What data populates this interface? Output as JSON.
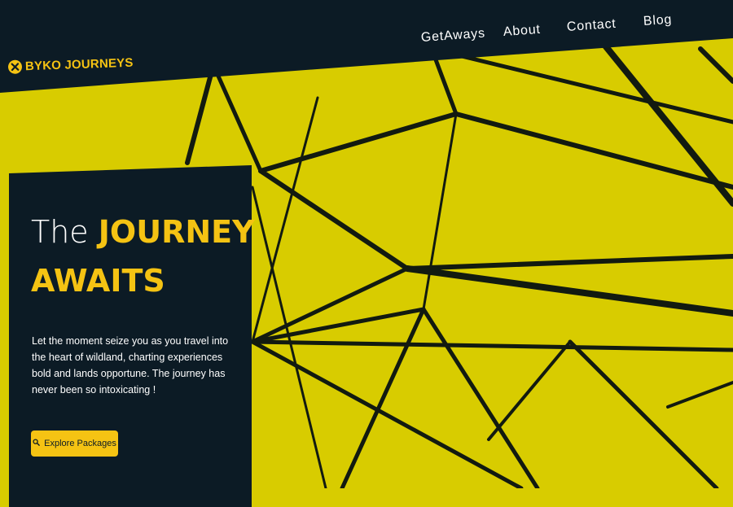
{
  "brand": {
    "name": "BYKO JOURNEYS",
    "logo_icon": "compass-icon",
    "color": "#f5c313"
  },
  "nav": {
    "items": [
      {
        "label": "GetAways"
      },
      {
        "label": "About"
      },
      {
        "label": "Contact"
      },
      {
        "label": "Blog"
      }
    ]
  },
  "hero": {
    "headline_light": "The",
    "headline_accent_1": "JOURNEY",
    "headline_accent_2": "AWAITS",
    "body": "Let the moment seize you as you travel into the heart of wildland, charting experiences bold and lands opportune. The journey has never been so intoxicating !",
    "cta_label": "Explore Packages",
    "cta_icon": "search-icon"
  },
  "colors": {
    "accent": "#f5c313",
    "dark": "#0c1b25",
    "background": "#d8cc00"
  }
}
